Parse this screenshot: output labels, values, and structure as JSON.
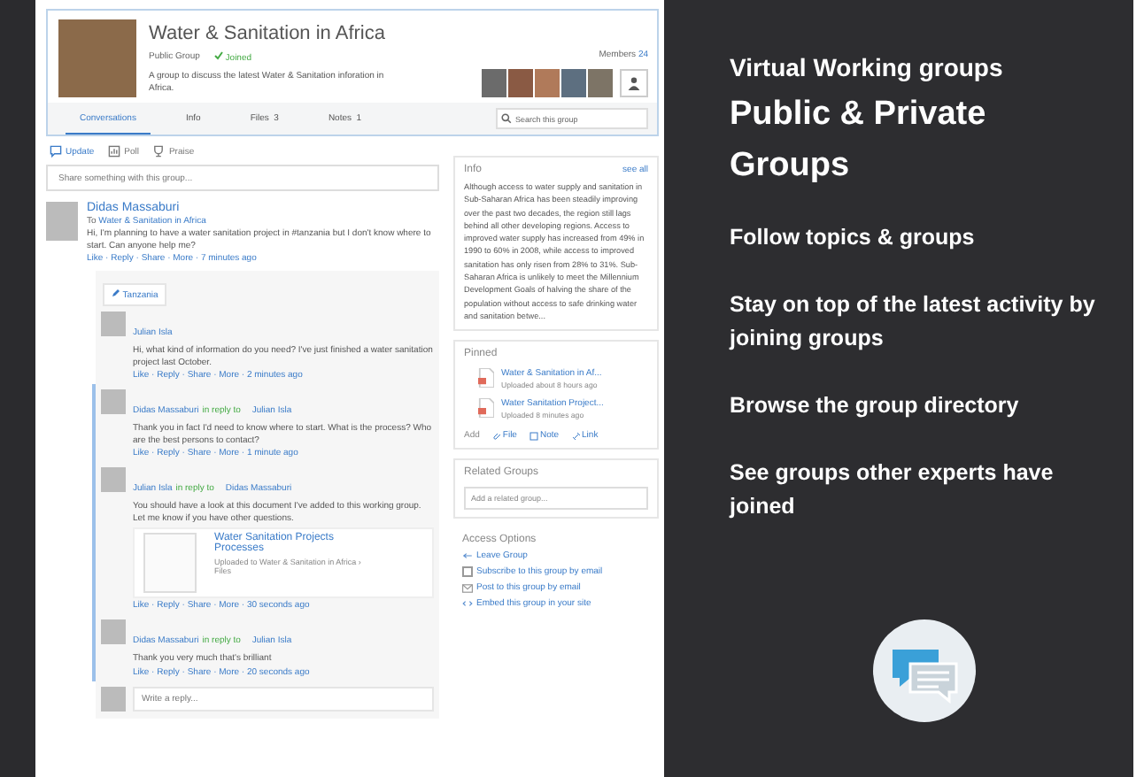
{
  "group": {
    "title": "Water & Sanitation in Africa",
    "privacy": "Public Group",
    "joined": true,
    "joined_label": "Joined",
    "description": "A group to discuss the latest Water & Sanitation inforation in Africa.",
    "members_label": "Members",
    "members_count": "24",
    "tabs": [
      {
        "label": "Conversations",
        "selected": true
      },
      {
        "label": "Info",
        "selected": false
      },
      {
        "label": "Files",
        "count": "3",
        "selected": false
      },
      {
        "label": "Notes",
        "count": "1",
        "selected": false
      }
    ],
    "search_placeholder": "Search this group"
  },
  "composer": {
    "actions": [
      {
        "kind": "update",
        "label": "Update",
        "selected": true
      },
      {
        "kind": "poll",
        "label": "Poll",
        "selected": false
      },
      {
        "kind": "praise",
        "label": "Praise",
        "selected": false
      }
    ],
    "placeholder": "Share something with this group..."
  },
  "post": {
    "author": "Didas Massaburi",
    "to_prefix": "To",
    "to_group": "Water & Sanitation in Africa",
    "text": "Hi, I'm planning to have a water sanitation project in #tanzania but I don't know where to start. Can anyone help me?",
    "meta": "Like · Reply · Share · More · 7 minutes ago",
    "tag": "Tanzania",
    "replies": [
      {
        "author": "Julian Isla",
        "text": "Hi, what kind of information do you need? I've just finished a water sanitation project last October.",
        "meta": "Like · Reply · Share · More · 2 minutes ago",
        "highlighted": false
      },
      {
        "author": "Didas Massaburi",
        "in_reply": "in reply to",
        "reply_to": "Julian Isla",
        "text": "Thank you in fact I'd need to know where to start. What is the process? Who are the best persons to contact?",
        "meta": "Like · Reply · Share · More · 1 minute ago",
        "highlighted": true
      },
      {
        "author": "Julian Isla",
        "in_reply": "in reply to",
        "reply_to": "Didas Massaburi",
        "text": "You should have a look at this document I've added to this working group. Let me know if you have other questions.",
        "meta": "Like · Reply · Share · More · 30 seconds ago",
        "highlighted": true,
        "attachment": {
          "title": "Water Sanitation Projects Processes",
          "meta": "Uploaded to Water & Sanitation in Africa › Files"
        }
      },
      {
        "author": "Didas Massaburi",
        "in_reply": "in reply to",
        "reply_to": "Julian Isla",
        "text": "Thank you very much that's brilliant",
        "meta": "Like · Reply · Share · More · 20 seconds ago",
        "highlighted": true
      }
    ],
    "reply_placeholder": "Write a reply..."
  },
  "info": {
    "heading": "Info",
    "see_all": "see all",
    "text": "Although access to water supply and sanitation in Sub-Saharan Africa has been steadily improving over the past two decades, the region still lags behind all other developing regions. Access to improved water supply has increased from 49% in 1990 to 60% in 2008, while access to improved sanitation has only risen from 28% to 31%. Sub-Saharan Africa is unlikely to meet the Millennium Development Goals of halving the share of the population without access to safe drinking water and sanitation betwe..."
  },
  "pinned": {
    "heading": "Pinned",
    "files": [
      {
        "name": "Water & Sanitation in Af...",
        "meta": "Uploaded about 8 hours ago"
      },
      {
        "name": "Water Sanitation Project...",
        "meta": "Uploaded 8 minutes ago"
      }
    ],
    "add_label": "Add",
    "add_actions": [
      {
        "kind": "file",
        "label": "File"
      },
      {
        "kind": "note",
        "label": "Note"
      },
      {
        "kind": "link",
        "label": "Link"
      }
    ]
  },
  "related": {
    "heading": "Related Groups",
    "placeholder": "Add a related group..."
  },
  "access": {
    "heading": "Access Options",
    "options": [
      {
        "kind": "leave",
        "label": "Leave Group"
      },
      {
        "kind": "checkbox",
        "label": "Subscribe to this group by email",
        "checked": false
      },
      {
        "kind": "mail",
        "label": "Post to this group by email"
      },
      {
        "kind": "embed",
        "label": "Embed this group in your site"
      }
    ]
  },
  "promo": {
    "subtitle": "Virtual Working groups",
    "title": "Public & Private Groups",
    "points": [
      "Follow topics & groups",
      "Stay on top of the latest activity by joining groups",
      "Browse the group directory",
      "See groups other experts have joined"
    ]
  }
}
